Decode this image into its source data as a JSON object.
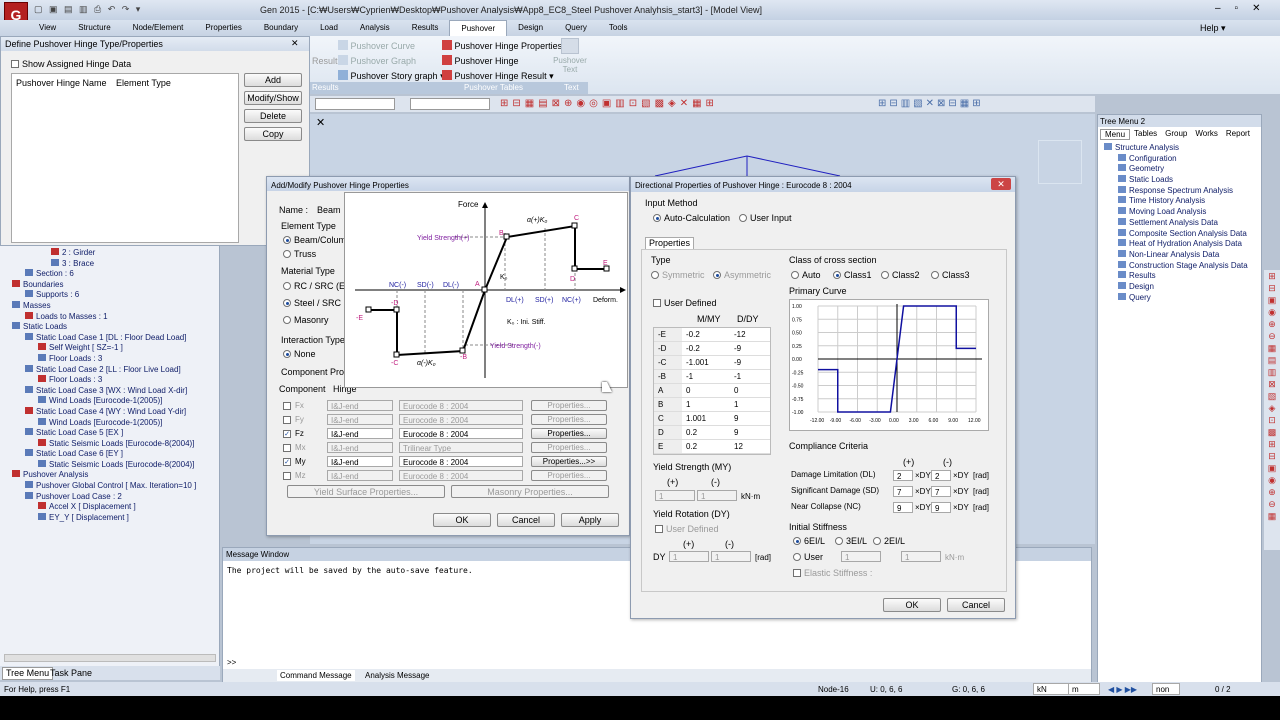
{
  "app": {
    "title": "Gen 2015 - [C:₩Users₩Cyprien₩Desktop₩Pushover Analysis₩App8_EC8_Steel Pushover Analyhsis_start3] - [Model View]",
    "help": "Help",
    "logo": "G"
  },
  "menu": [
    "View",
    "Structure",
    "Node/Element",
    "Properties",
    "Boundary",
    "Load",
    "Analysis",
    "Results",
    "Pushover",
    "Design",
    "Query",
    "Tools"
  ],
  "ribbon": {
    "results_tag": "Result",
    "g1": [
      "Pushover Curve",
      "Pushover Graph",
      "Pushover Story graph"
    ],
    "g2": [
      "Pushover Hinge Properties",
      "Pushover Hinge",
      "Pushover Hinge Result"
    ],
    "g3": "Pushover Text",
    "labels": [
      "Results",
      "Pushover Tables",
      "Text"
    ]
  },
  "hinge_panel": {
    "title": "Define Pushover Hinge Type/Properties",
    "show": "Show Assigned Hinge Data",
    "col1": "Pushover Hinge Name",
    "col2": "Element Type",
    "buttons": [
      "Add",
      "Modify/Show",
      "Delete",
      "Copy"
    ]
  },
  "tree": {
    "items": [
      "2 : Girder",
      "3 : Brace",
      "Section : 6",
      "Boundaries",
      "Supports : 6",
      "Masses",
      "Loads to Masses : 1",
      "Static Loads",
      "Static Load Case 1 [DL : Floor Dead Load]",
      "Self Weight [ SZ=-1 ]",
      "Floor Loads : 3",
      "Static Load Case 2 [LL : Floor Live Load]",
      "Floor Loads : 3",
      "Static Load Case 3 [WX : Wind Load X-dir]",
      "Wind Loads [Eurocode-1(2005)]",
      "Static Load Case 4 [WY : Wind Load Y-dir]",
      "Wind Loads [Eurocode-1(2005)]",
      "Static Load Case 5 [EX ]",
      "Static Seismic Loads [Eurocode-8(2004)]",
      "Static Load Case 6 [EY ]",
      "Static Seismic Loads [Eurocode-8(2004)]",
      "Pushover Analysis",
      "Pushover Global Control [ Max. Iteration=10 ]",
      "Pushover Load Case : 2",
      "Accel X [ Displacement ]",
      "EY_Y [ Displacement ]"
    ],
    "tabs": [
      "Tree Menu",
      "Task Pane"
    ]
  },
  "tree2": {
    "title": "Tree Menu 2",
    "tabs": [
      "Menu",
      "Tables",
      "Group",
      "Works",
      "Report"
    ],
    "items": [
      "Structure Analysis",
      "Configuration",
      "Geometry",
      "Static Loads",
      "Response Spectrum Analysis",
      "Time History Analysis",
      "Moving Load Analysis",
      "Settlement Analysis Data",
      "Composite Section Analysis Data",
      "Heat of Hydration Analysis Data",
      "Non-Linear Analysis Data",
      "Construction Stage Analysis Data",
      "Results",
      "Design",
      "Query"
    ]
  },
  "add_dialog": {
    "title": "Add/Modify Pushover Hinge Properties",
    "name_lbl": "Name :",
    "name_val": "Beam",
    "etype": "Element Type",
    "etype_opts": [
      "Beam/Column",
      "Truss"
    ],
    "mat": "Material Type",
    "mat_opts": [
      "RC / SRC (Encased)",
      "Steel / SRC (Filled)",
      "Masonry"
    ],
    "inter": "Interaction Type",
    "none": "None",
    "comp_prop": "Component Properties",
    "comp": "Component",
    "hinge": "Hinge",
    "rows": [
      {
        "c": "Fx",
        "on": false,
        "pos": "I&J-end",
        "code": "Eurocode 8 : 2004",
        "btn": "Properties..."
      },
      {
        "c": "Fy",
        "on": false,
        "pos": "I&J-end",
        "code": "Eurocode 8 : 2004",
        "btn": "Properties..."
      },
      {
        "c": "Fz",
        "on": true,
        "pos": "I&J-end",
        "code": "Eurocode 8 : 2004",
        "btn": "Properties..."
      },
      {
        "c": "Mx",
        "on": false,
        "pos": "I&J-end",
        "code": "Trilinear Type",
        "btn": "Properties..."
      },
      {
        "c": "My",
        "on": true,
        "pos": "I&J-end",
        "code": "Eurocode 8 : 2004",
        "btn": "Properties...>>"
      },
      {
        "c": "Mz",
        "on": false,
        "pos": "I&J-end",
        "code": "Eurocode 8 : 2004",
        "btn": "Properties..."
      }
    ],
    "ysp": "Yield Surface Properties...",
    "masonry": "Masonry Properties...",
    "ok": "OK",
    "cancel": "Cancel",
    "apply": "Apply"
  },
  "diagram": {
    "force": "Force",
    "deform": "Deform.",
    "yp": "Yield Strength(+)",
    "yn": "Yield Strength(-)",
    "ko": "K₀",
    "init": "K₀ : Ini. Stiff.",
    "ap": "α(+)K₀",
    "an": "α(-)K₀",
    "pos": [
      "DL(+)",
      "SD(+)",
      "NC(+)"
    ],
    "neg": [
      "NC(-)",
      "SD(-)",
      "DL(-)"
    ],
    "pts": [
      "A",
      "B",
      "C",
      "D",
      "E",
      "-B",
      "-C",
      "-D",
      "-E"
    ]
  },
  "dir_dialog": {
    "title": "Directional Properties of Pushover Hinge  : Eurocode 8 : 2004",
    "input_method": "Input Method",
    "auto": "Auto-Calculation",
    "user": "User Input",
    "props_tab": "Properties",
    "type": "Type",
    "sym": "Symmetric",
    "asym": "Asymmetric",
    "user_def": "User Defined",
    "cols": [
      "M/MY",
      "D/DY"
    ],
    "table": [
      [
        "-E",
        "-0.2",
        "-12"
      ],
      [
        "-D",
        "-0.2",
        "-9"
      ],
      [
        "-C",
        "-1.001",
        "-9"
      ],
      [
        "-B",
        "-1",
        "-1"
      ],
      [
        "A",
        "0",
        "0"
      ],
      [
        "B",
        "1",
        "1"
      ],
      [
        "C",
        "1.001",
        "9"
      ],
      [
        "D",
        "0.2",
        "9"
      ],
      [
        "E",
        "0.2",
        "12"
      ]
    ],
    "cls": "Class of cross section",
    "cls_opts": [
      "Auto",
      "Class1",
      "Class2",
      "Class3"
    ],
    "primary": "Primary Curve",
    "ys": "Yield Strength (MY)",
    "plus": "(+)",
    "minus": "(-)",
    "ys_vals": [
      "1",
      "1"
    ],
    "ys_unit": "kN·m",
    "yr": "Yield Rotation (DY)",
    "yr_user": "User Defined",
    "dy": "DY",
    "yr_vals": [
      "1",
      "1"
    ],
    "rad": "[rad]",
    "comp": "Compliance Criteria",
    "crit": [
      {
        "n": "Damage Limitation (DL)",
        "p": "2",
        "m": "2"
      },
      {
        "n": "Significant Damage (SD)",
        "p": "7",
        "m": "7"
      },
      {
        "n": "Near Collapse (NC)",
        "p": "9",
        "m": "9"
      }
    ],
    "xdy": "×DY",
    "init": "Initial Stiffness",
    "init_opts": [
      "6EI/L",
      "3EI/L",
      "2EI/L"
    ],
    "user_opt": "User",
    "user_vals": [
      "1",
      "1"
    ],
    "kn_m": "kN·m",
    "elastic": "Elastic Stiffness :",
    "ok": "OK",
    "cancel": "Cancel",
    "yticks": [
      "1.00",
      "0.75",
      "0.50",
      "0.25",
      "0.00",
      "-0.25",
      "-0.50",
      "-0.75",
      "-1.00"
    ],
    "xticks": [
      "-12.00",
      "-9.00",
      "-6.00",
      "-3.00",
      "0.00",
      "3.00",
      "6.00",
      "9.00",
      "12.00"
    ]
  },
  "msg": {
    "title": "Message Window",
    "text": "The project will be saved by the auto-save feature.",
    "tabs": [
      "Command Message",
      "Analysis Message"
    ],
    "prompt": ">>"
  },
  "status": {
    "help": "For Help, press F1",
    "node": "Node-16",
    "u": "U: 0, 6, 6",
    "g": "G: 0, 6, 6",
    "unit1": "kN",
    "unit2": "m",
    "none": "non",
    "pages": "0 / 2"
  }
}
